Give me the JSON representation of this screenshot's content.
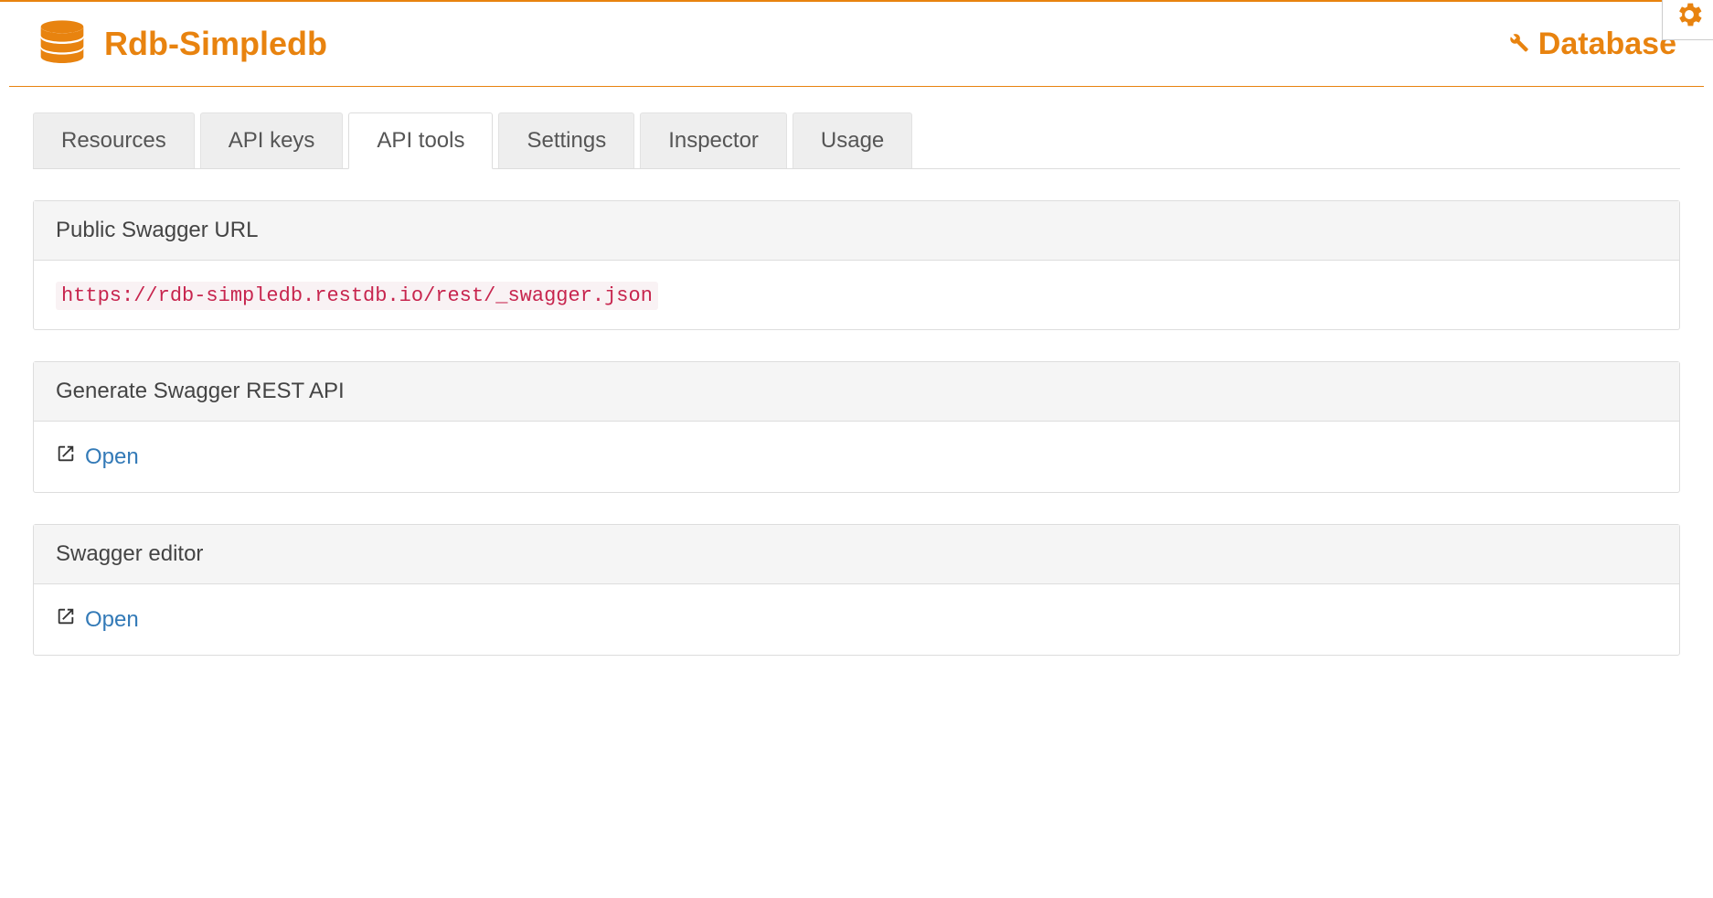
{
  "colors": {
    "accent": "#e8830f",
    "link": "#337ab7",
    "code": "#c7254e"
  },
  "header": {
    "title": "Rdb-Simpledb",
    "database_link": "Database"
  },
  "tabs": [
    {
      "label": "Resources",
      "active": false
    },
    {
      "label": "API keys",
      "active": false
    },
    {
      "label": "API tools",
      "active": true
    },
    {
      "label": "Settings",
      "active": false
    },
    {
      "label": "Inspector",
      "active": false
    },
    {
      "label": "Usage",
      "active": false
    }
  ],
  "panels": {
    "swagger_url": {
      "title": "Public Swagger URL",
      "url": "https://rdb-simpledb.restdb.io/rest/_swagger.json"
    },
    "generate_api": {
      "title": "Generate Swagger REST API",
      "link_label": "Open"
    },
    "swagger_editor": {
      "title": "Swagger editor",
      "link_label": "Open"
    }
  }
}
